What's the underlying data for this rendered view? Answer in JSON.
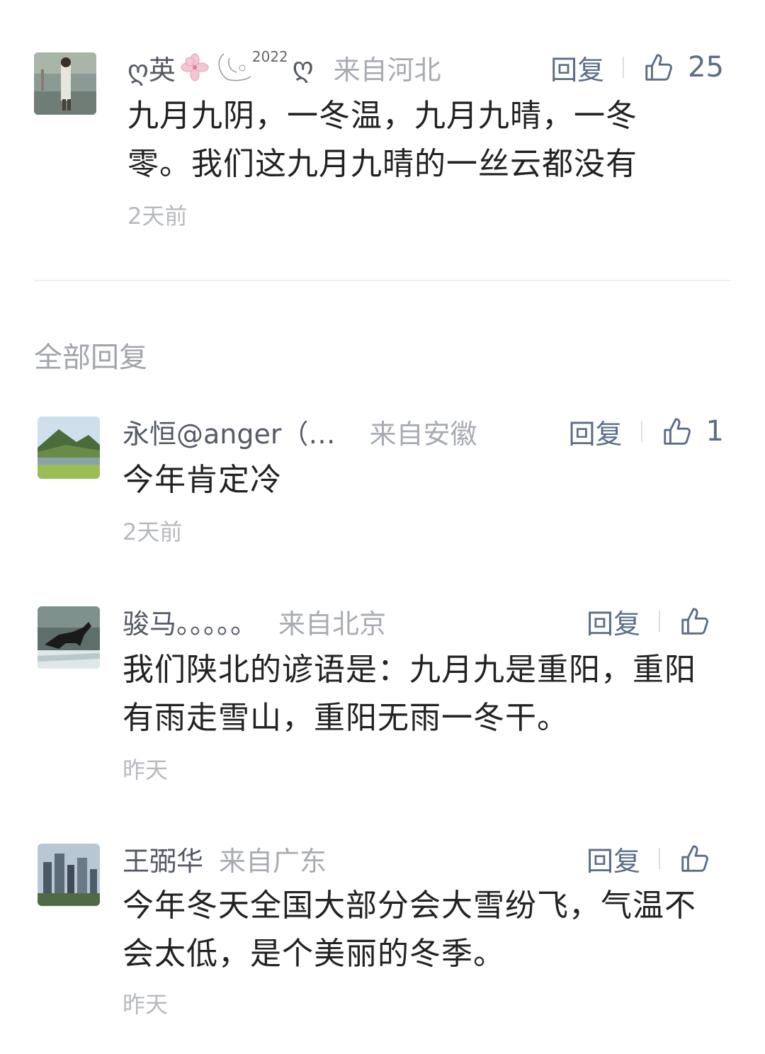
{
  "top_comment": {
    "username_prefix": "ღ英",
    "username_year": "2022",
    "username_suffix": "ღ",
    "location": "来自河北",
    "reply_label": "回复",
    "likes": "25",
    "text": "九月九阴，一冬温，九月九晴，一冬零。我们这九月九晴的一丝云都没有",
    "time": "2天前"
  },
  "section_title": "全部回复",
  "replies": [
    {
      "username": "永恒@anger（…",
      "location": "来自安徽",
      "reply_label": "回复",
      "likes": "1",
      "text": "今年肯定冷",
      "time": "2天前"
    },
    {
      "username": "骏马。。。。。",
      "location": "来自北京",
      "reply_label": "回复",
      "likes": "",
      "text": "我们陕北的谚语是：九月九是重阳，重阳有雨走雪山，重阳无雨一冬干。",
      "time": "昨天"
    },
    {
      "username": "王弼华",
      "location": "来自广东",
      "reply_label": "回复",
      "likes": "",
      "text": "今年冬天全国大部分会大雪纷飞，气温不会太低，是个美丽的冬季。",
      "time": "昨天"
    }
  ],
  "colors": {
    "accent": "#5b6d86",
    "muted": "#a8acb2",
    "time": "#b6b9be"
  }
}
